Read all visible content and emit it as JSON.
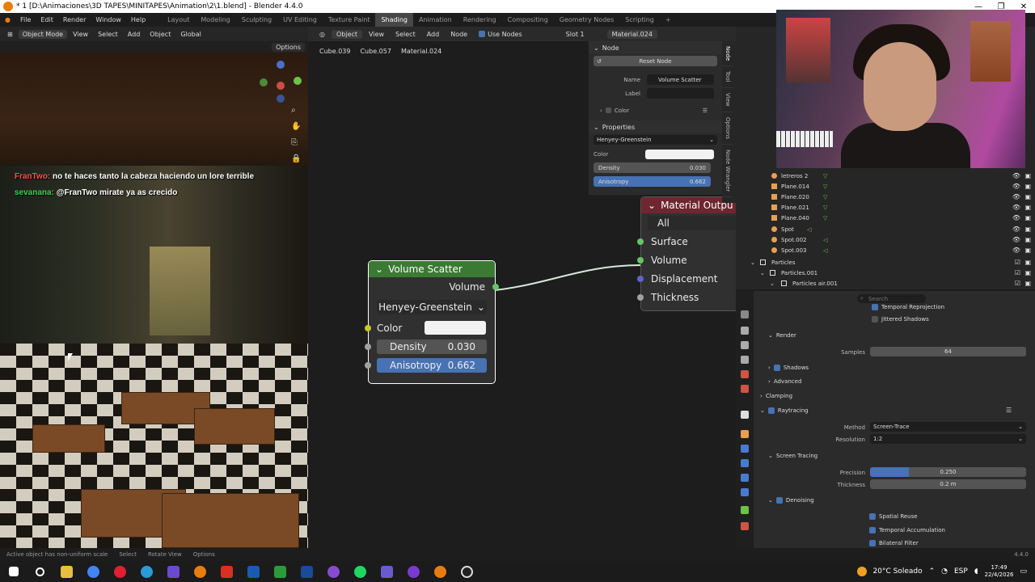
{
  "window": {
    "title": "* 1 [D:\\Animaciones\\3D TAPES\\MINITAPES\\Animation\\2\\1.blend] - Blender 4.4.0",
    "controls": [
      "—",
      "❐",
      "✕"
    ]
  },
  "menubar": {
    "menus": [
      "File",
      "Edit",
      "Render",
      "Window",
      "Help"
    ],
    "workspaces": [
      "Layout",
      "Modeling",
      "Sculpting",
      "UV Editing",
      "Texture Paint",
      "Shading",
      "Animation",
      "Rendering",
      "Compositing",
      "Geometry Nodes",
      "Scripting"
    ],
    "active_workspace": "Shading",
    "add_tab": "+"
  },
  "viewport": {
    "mode": "Object Mode",
    "menus": [
      "View",
      "Select",
      "Add",
      "Object"
    ],
    "orientation": "Global",
    "options_label": "Options",
    "chat": [
      {
        "user": "FranTwo:",
        "message": "no te haces tanto la cabeza haciendo un lore terrible"
      },
      {
        "user": "sevanana:",
        "message": "@FranTwo mirate ya as crecido"
      }
    ]
  },
  "node_editor": {
    "object_selector": "Object",
    "menus": [
      "View",
      "Select",
      "Add",
      "Node"
    ],
    "use_nodes_label": "Use Nodes",
    "slot": "Slot 1",
    "material": "Material.024",
    "breadcrumb": [
      "Cube.039",
      "Cube.057",
      "Material.024"
    ],
    "volume_scatter": {
      "title": "Volume Scatter",
      "output": "Volume",
      "phase": "Henyey-Greenstein",
      "color_label": "Color",
      "density_label": "Density",
      "density_value": "0.030",
      "anisotropy_label": "Anisotropy",
      "anisotropy_value": "0.662"
    },
    "material_output": {
      "title": "Material Outpu",
      "target": "All",
      "inputs": [
        "Surface",
        "Volume",
        "Displacement",
        "Thickness"
      ]
    }
  },
  "npanel": {
    "node_section": "Node",
    "reset_node": "Reset Node",
    "name_label": "Name",
    "name_value": "Volume Scatter",
    "label_label": "Label",
    "color_section": "Color",
    "properties_section": "Properties",
    "phase": "Henyey-Greenstein",
    "color_label": "Color",
    "density_label": "Density",
    "density_value": "0.030",
    "anisotropy_label": "Anisotropy",
    "anisotropy_value": "0.662",
    "tabs": [
      "Node",
      "Tool",
      "View",
      "Options",
      "Node Wrangler"
    ]
  },
  "outliner": {
    "items": [
      {
        "name": "letreros 2",
        "indent": 2
      },
      {
        "name": "Plane.014",
        "indent": 2
      },
      {
        "name": "Plane.020",
        "indent": 2
      },
      {
        "name": "Plane.021",
        "indent": 2
      },
      {
        "name": "Plane.040",
        "indent": 2
      },
      {
        "name": "Spot",
        "indent": 2
      },
      {
        "name": "Spot.002",
        "indent": 2
      },
      {
        "name": "Spot.003",
        "indent": 2
      },
      {
        "name": "Particles",
        "indent": 1
      },
      {
        "name": "Particles.001",
        "indent": 2
      },
      {
        "name": "Particles air.001",
        "indent": 3
      }
    ]
  },
  "properties": {
    "search_placeholder": "Search",
    "temporal_reprojection": "Temporal Reprojection",
    "jittered_shadows": "Jittered Shadows",
    "render_section": "Render",
    "samples_label": "Samples",
    "samples_value": "64",
    "shadows": "Shadows",
    "advanced": "Advanced",
    "clamping": "Clamping",
    "raytracing": "Raytracing",
    "method_label": "Method",
    "method_value": "Screen-Trace",
    "resolution_label": "Resolution",
    "resolution_value": "1:2",
    "screen_tracing": "Screen Tracing",
    "precision_label": "Precision",
    "precision_value": "0.250",
    "precision_fraction": 0.25,
    "thickness_label": "Thickness",
    "thickness_value": "0.2 m",
    "denoising": "Denoising",
    "spatial_reuse": "Spatial Reuse",
    "temporal_accumulation": "Temporal Accumulation",
    "bilateral_filter": "Bilateral Filter"
  },
  "statusbar": {
    "message": "Active object has non-uniform scale",
    "hints": [
      "Select",
      "Rotate View",
      "Options"
    ],
    "version": "4.4.0"
  },
  "taskbar": {
    "weather": "20°C Soleado",
    "language": "ESP",
    "time": "17:49",
    "date": "22/4/2026"
  },
  "colors": {
    "accent_blue": "#4772b3",
    "node_header_green": "#3a7a33",
    "node_header_red": "#6e2631",
    "socket_green": "#63c763",
    "socket_purple": "#6363c7",
    "socket_yellow": "#c7c729",
    "socket_grey": "#a1a1a1",
    "active_tab": "#474747"
  }
}
